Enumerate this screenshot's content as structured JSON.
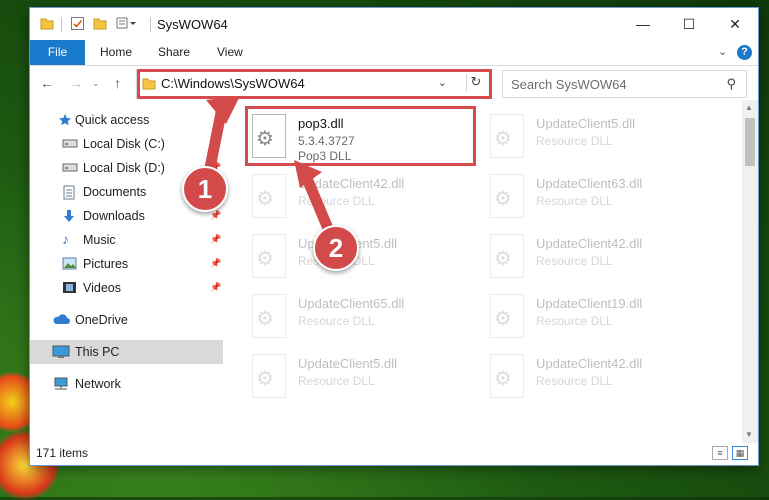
{
  "window": {
    "title": "SysWOW64",
    "minimize_icon": "minimize-icon",
    "maximize_icon": "maximize-icon",
    "close_icon": "close-icon"
  },
  "ribbon": {
    "tabs": [
      {
        "label": "File"
      },
      {
        "label": "Home"
      },
      {
        "label": "Share"
      },
      {
        "label": "View"
      }
    ],
    "help_label": "?"
  },
  "address": {
    "path": "C:\\Windows\\SysWOW64",
    "search_placeholder": "Search SysWOW64"
  },
  "sidebar": {
    "items": [
      {
        "label": "Quick access",
        "icon": "star-icon",
        "pinned": false
      },
      {
        "label": "Local Disk (C:)",
        "icon": "drive-icon",
        "pinned": true
      },
      {
        "label": "Local Disk (D:)",
        "icon": "drive-icon",
        "pinned": true
      },
      {
        "label": "Documents",
        "icon": "documents-icon",
        "pinned": true
      },
      {
        "label": "Downloads",
        "icon": "download-icon",
        "pinned": true
      },
      {
        "label": "Music",
        "icon": "music-icon",
        "pinned": true
      },
      {
        "label": "Pictures",
        "icon": "pictures-icon",
        "pinned": true
      },
      {
        "label": "Videos",
        "icon": "videos-icon",
        "pinned": true
      },
      {
        "label": "OneDrive",
        "icon": "cloud-icon",
        "pinned": false
      },
      {
        "label": "This PC",
        "icon": "computer-icon",
        "pinned": false,
        "selected": true
      },
      {
        "label": "Network",
        "icon": "network-icon",
        "pinned": false
      }
    ]
  },
  "files": [
    {
      "name": "pop3.dll",
      "line2": "5.3.4.3727",
      "line3": "Pop3 DLL",
      "highlighted": true
    },
    {
      "name": "UpdateClient5.dll",
      "line2": "Resource DLL"
    },
    {
      "name": "UpdateClient42.dll",
      "line2": "Resource DLL"
    },
    {
      "name": "UpdateClient63.dll",
      "line2": "Resource DLL"
    },
    {
      "name": "UpdateClient5.dll",
      "line2": "Resource DLL"
    },
    {
      "name": "UpdateClient42.dll",
      "line2": "Resource DLL"
    },
    {
      "name": "UpdateClient65.dll",
      "line2": "Resource DLL"
    },
    {
      "name": "UpdateClient19.dll",
      "line2": "Resource DLL"
    },
    {
      "name": "UpdateClient5.dll",
      "line2": "Resource DLL"
    },
    {
      "name": "UpdateClient42.dll",
      "line2": "Resource DLL"
    }
  ],
  "status": {
    "item_count": "171 items"
  },
  "annotations": {
    "step1": "1",
    "step2": "2",
    "highlight_color": "#d64c4c"
  }
}
